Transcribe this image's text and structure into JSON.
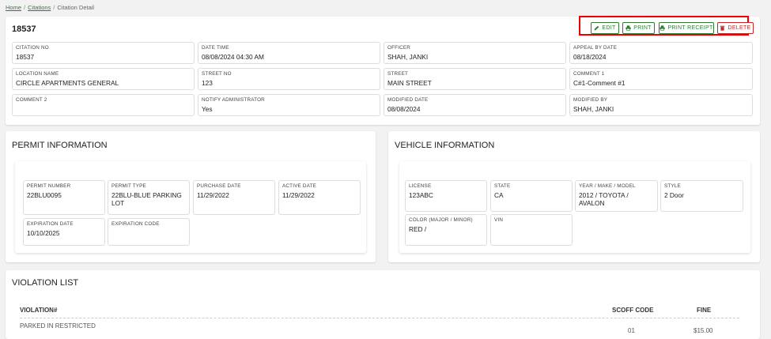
{
  "breadcrumb": {
    "home": "Home",
    "sep1": "/",
    "citations": "Citations",
    "sep2": "/",
    "current": "Citation Detail"
  },
  "header": {
    "citation_no": "18537",
    "buttons": {
      "edit": "EDIT",
      "print": "PRINT",
      "print_receipt": "PRINT RECEIPT",
      "delete": "DELETE"
    }
  },
  "fields": {
    "citation_no": {
      "label": "CITATION NO",
      "value": "18537"
    },
    "date_time": {
      "label": "DATE TIME",
      "value": "08/08/2024 04:30 AM"
    },
    "officer": {
      "label": "OFFICER",
      "value": "SHAH, JANKI"
    },
    "appeal_by_date": {
      "label": "APPEAL BY DATE",
      "value": "08/18/2024"
    },
    "location_name": {
      "label": "LOCATION NAME",
      "value": "CIRCLE APARTMENTS GENERAL"
    },
    "street_no": {
      "label": "STREET NO",
      "value": "123"
    },
    "street": {
      "label": "STREET",
      "value": "MAIN STREET"
    },
    "comment1": {
      "label": "COMMENT 1",
      "value": "C#1-Comment #1"
    },
    "comment2": {
      "label": "COMMENT 2",
      "value": ""
    },
    "notify_admin": {
      "label": "NOTIFY ADMINISTRATOR",
      "value": "Yes"
    },
    "modified_date": {
      "label": "MODIFIED DATE",
      "value": "08/08/2024"
    },
    "modified_by": {
      "label": "MODIFIED BY",
      "value": "SHAH, JANKI"
    }
  },
  "permit": {
    "title": "PERMIT INFORMATION",
    "permit_number": {
      "label": "PERMIT NUMBER",
      "value": "22BLU0095"
    },
    "permit_type": {
      "label": "PERMIT TYPE",
      "value": "22BLU-BLUE PARKING LOT"
    },
    "purchase_date": {
      "label": "PURCHASE DATE",
      "value": "11/29/2022"
    },
    "active_date": {
      "label": "ACTIVE DATE",
      "value": "11/29/2022"
    },
    "expiration_date": {
      "label": "EXPIRATION DATE",
      "value": "10/10/2025"
    },
    "expiration_code": {
      "label": "EXPIRATION CODE",
      "value": ""
    }
  },
  "vehicle": {
    "title": "VEHICLE INFORMATION",
    "license": {
      "label": "LICENSE",
      "value": "123ABC"
    },
    "state": {
      "label": "STATE",
      "value": "CA"
    },
    "ymm": {
      "label": "YEAR / MAKE / MODEL",
      "value": "2012 / TOYOTA / AVALON"
    },
    "style": {
      "label": "STYLE",
      "value": "2 Door"
    },
    "color": {
      "label": "COLOR (MAJOR / MINOR)",
      "value": "RED /"
    },
    "vin": {
      "label": "VIN",
      "value": ""
    }
  },
  "violations": {
    "title": "VIOLATION LIST",
    "columns": {
      "violation": "VIOLATION#",
      "scoff_code": "SCOFF CODE",
      "fine": "FINE"
    },
    "rows": [
      {
        "violation": "PARKED IN RESTRICTED",
        "scoff_code": "01",
        "fine": "$15.00"
      }
    ]
  }
}
